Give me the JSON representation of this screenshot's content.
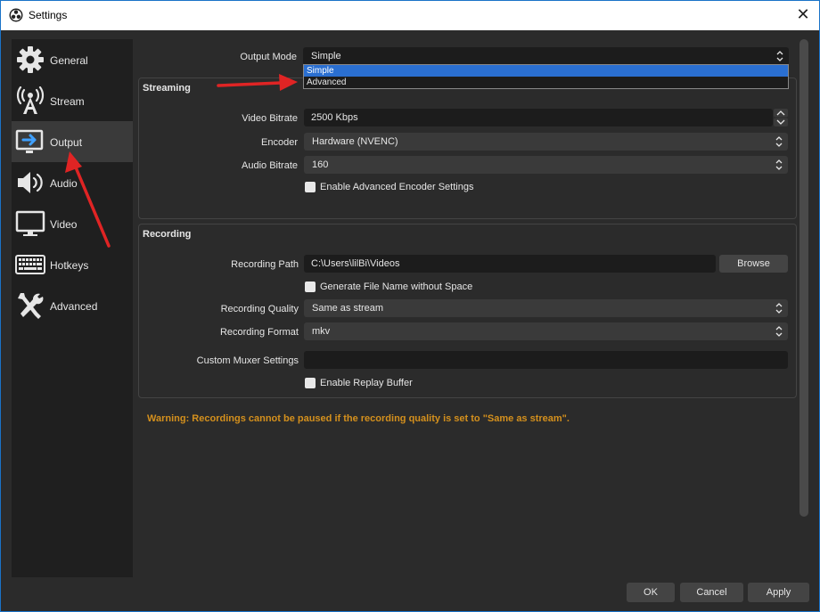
{
  "window": {
    "title": "Settings",
    "close_glyph": "✕"
  },
  "sidebar": {
    "items": [
      {
        "label": "General",
        "icon": "gear-icon"
      },
      {
        "label": "Stream",
        "icon": "broadcast-icon"
      },
      {
        "label": "Output",
        "icon": "output-icon",
        "active": true
      },
      {
        "label": "Audio",
        "icon": "speaker-icon"
      },
      {
        "label": "Video",
        "icon": "monitor-icon"
      },
      {
        "label": "Hotkeys",
        "icon": "keyboard-icon"
      },
      {
        "label": "Advanced",
        "icon": "tools-icon"
      }
    ]
  },
  "output_mode": {
    "label": "Output Mode",
    "value": "Simple",
    "options": [
      "Simple",
      "Advanced"
    ],
    "highlighted": "Simple"
  },
  "streaming": {
    "title": "Streaming",
    "video_bitrate": {
      "label": "Video Bitrate",
      "value": "2500 Kbps"
    },
    "encoder": {
      "label": "Encoder",
      "value": "Hardware (NVENC)"
    },
    "audio_bitrate": {
      "label": "Audio Bitrate",
      "value": "160"
    },
    "advanced_encoder": {
      "label": "Enable Advanced Encoder Settings",
      "checked": false
    }
  },
  "recording": {
    "title": "Recording",
    "path": {
      "label": "Recording Path",
      "value": "C:\\Users\\lilBi\\Videos",
      "browse_label": "Browse"
    },
    "no_space": {
      "label": "Generate File Name without Space",
      "checked": false
    },
    "quality": {
      "label": "Recording Quality",
      "value": "Same as stream"
    },
    "format": {
      "label": "Recording Format",
      "value": "mkv"
    },
    "muxer": {
      "label": "Custom Muxer Settings",
      "value": ""
    },
    "replay_buffer": {
      "label": "Enable Replay Buffer",
      "checked": false
    }
  },
  "warning": "Warning: Recordings cannot be paused if the recording quality is set to \"Same as stream\".",
  "footer": {
    "ok": "OK",
    "cancel": "Cancel",
    "apply": "Apply"
  },
  "colors": {
    "accent": "#2a6fd1",
    "warning": "#d4901d",
    "annotation_arrow": "#e02424",
    "panel": "#2b2b2b",
    "sidebar": "#1f1f1f"
  }
}
